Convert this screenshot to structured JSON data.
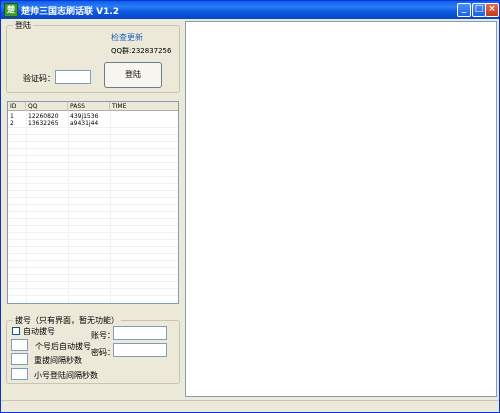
{
  "window": {
    "title": "楚帅三国志刷话联 V1.2",
    "icon_text": "楚",
    "min_symbol": "_",
    "max_symbol": "□",
    "close_symbol": "×"
  },
  "login": {
    "group_title": "登陆",
    "check_update": "检查更新",
    "qq_group": "QQ群:232837256",
    "captcha_label": "验证码：",
    "captcha_value": "",
    "login_button": "登陆"
  },
  "accounts": {
    "columns": [
      "ID",
      "QQ",
      "PASS",
      "TIME"
    ],
    "rows": [
      {
        "id": "1",
        "qq": "12260820",
        "pass": "439j1536",
        "time": ""
      },
      {
        "id": "2",
        "qq": "13632265",
        "pass": "a9431j44",
        "time": ""
      }
    ]
  },
  "dialer": {
    "group_title": "拔号（只有界面，暂无功能）",
    "auto_dial_label": "自动拔号",
    "auto_dial_checked": false,
    "per_count_value": "",
    "per_count_label": "个号后自动拔号",
    "redial_value": "",
    "redial_label": "重拔间隔秒数",
    "small_login_value": "",
    "small_login_label": "小号登陆间隔秒数",
    "account_label": "账号：",
    "account_value": "",
    "password_label": "密码：",
    "password_value": ""
  }
}
